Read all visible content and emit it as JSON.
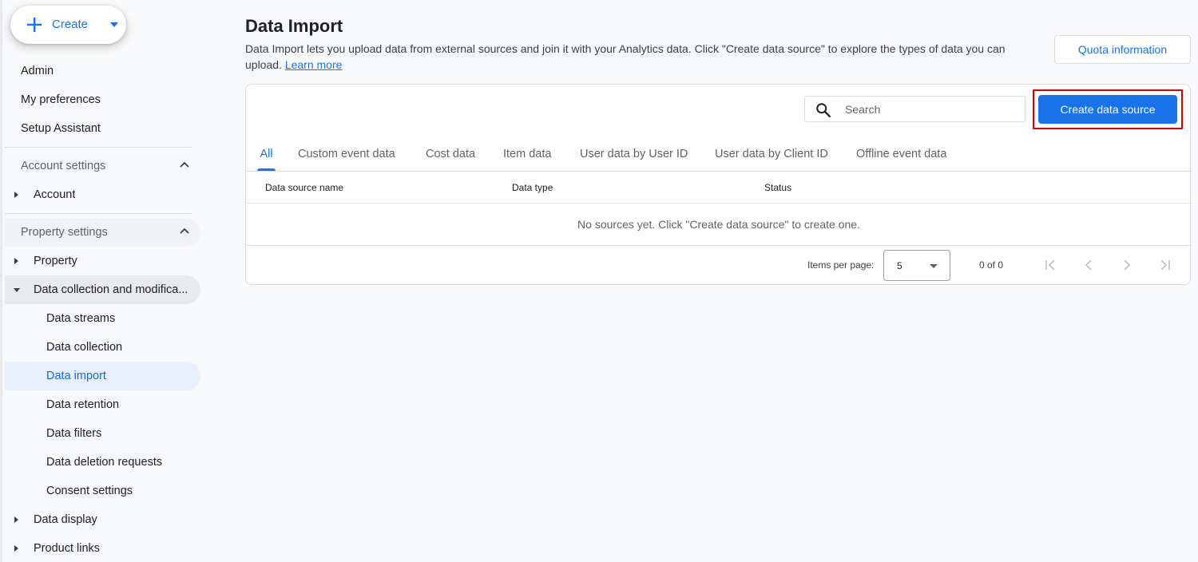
{
  "sidebar": {
    "create_label": "Create",
    "top_items": [
      "Admin",
      "My preferences",
      "Setup Assistant"
    ],
    "account_settings": {
      "label": "Account settings",
      "items": [
        "Account"
      ]
    },
    "property_settings": {
      "label": "Property settings",
      "property": "Property",
      "data_collection": {
        "label": "Data collection and modifica...",
        "children": [
          "Data streams",
          "Data collection",
          "Data import",
          "Data retention",
          "Data filters",
          "Data deletion requests",
          "Consent settings"
        ],
        "active": "Data import"
      },
      "data_display": "Data display",
      "product_links": "Product links"
    }
  },
  "main": {
    "title": "Data Import",
    "description": "Data Import lets you upload data from external sources and join it with your Analytics data. Click \"Create data source\" to explore the types of data you can upload.",
    "learn_more": "Learn more",
    "quota_button": "Quota information",
    "search": {
      "placeholder": "Search",
      "value": ""
    },
    "create_button": "Create data source",
    "tabs": [
      "All",
      "Custom event data",
      "Cost data",
      "Item data",
      "User data by User ID",
      "User data by Client ID",
      "Offline event data"
    ],
    "active_tab": "All",
    "table": {
      "columns": [
        "Data source name",
        "Data type",
        "Status"
      ],
      "empty_message": "No sources yet. Click \"Create data source\" to create one."
    },
    "paginator": {
      "items_per_page_label": "Items per page:",
      "items_per_page_value": "5",
      "range": "0 of 0"
    }
  },
  "colors": {
    "accent": "#1a73e8",
    "highlight_box": "#d50000",
    "active_nav_bg": "#e8f0fe"
  }
}
